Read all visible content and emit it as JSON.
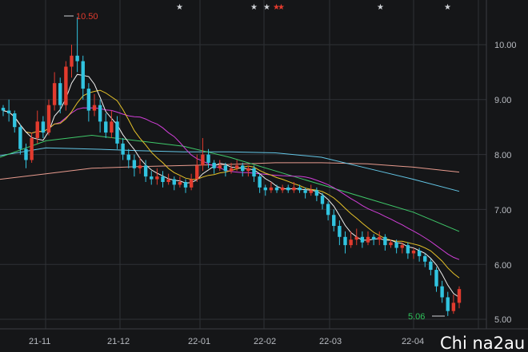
{
  "chart_data": {
    "type": "candlestick",
    "y_ticks": [
      "10.00",
      "9.00",
      "8.00",
      "7.00",
      "6.00",
      "5.00"
    ],
    "x_labels": [
      "21-11",
      "21-12",
      "22-01",
      "22-02",
      "22-03",
      "22-04"
    ],
    "annotations": {
      "high": "10.50",
      "low": "5.06"
    },
    "colors": {
      "up": "#e23b2e",
      "down": "#31c4e0",
      "ma5": "#f0f0f0",
      "ma10": "#e6c229",
      "ma20": "#d13fd8",
      "ma60": "#3fc96a",
      "ma120": "#63c6e6",
      "ma250": "#e89b8e",
      "grid": "#2f3136",
      "background": "#151618"
    },
    "markers": [
      {
        "type": "star"
      },
      {
        "type": "star"
      },
      {
        "type": "star"
      },
      {
        "type": "star-red"
      },
      {
        "type": "star-red"
      },
      {
        "type": "star"
      },
      {
        "type": "star"
      }
    ],
    "ma60_series": [
      7.95,
      8.25,
      8.35,
      8.25,
      8.15,
      7.95,
      7.7,
      7.45,
      7.2,
      6.95,
      6.6
    ],
    "ma120_series": [
      7.98,
      8.12,
      8.1,
      8.07,
      8.05,
      8.05,
      8.03,
      7.95,
      7.75,
      7.55,
      7.33
    ],
    "ma250_series": [
      7.55,
      7.65,
      7.75,
      7.78,
      7.8,
      7.82,
      7.85,
      7.85,
      7.83,
      7.77,
      7.68
    ],
    "candles": [
      [
        8.85,
        8.8,
        8.9,
        8.7
      ],
      [
        8.8,
        8.75,
        9.0,
        8.6
      ],
      [
        8.75,
        8.5,
        8.8,
        8.4
      ],
      [
        8.5,
        8.1,
        8.55,
        8.0
      ],
      [
        8.1,
        7.9,
        8.2,
        7.75
      ],
      [
        7.9,
        8.3,
        8.4,
        7.85
      ],
      [
        8.3,
        8.6,
        8.8,
        8.2
      ],
      [
        8.6,
        8.4,
        8.7,
        8.3
      ],
      [
        8.4,
        8.9,
        9.0,
        8.35
      ],
      [
        8.9,
        9.3,
        9.5,
        8.8
      ],
      [
        9.3,
        8.9,
        9.4,
        8.75
      ],
      [
        8.9,
        9.6,
        9.7,
        8.8
      ],
      [
        9.6,
        9.8,
        10.0,
        9.4
      ],
      [
        9.8,
        9.7,
        10.5,
        9.5
      ],
      [
        9.7,
        9.2,
        9.8,
        9.0
      ],
      [
        9.2,
        8.8,
        9.3,
        8.6
      ],
      [
        8.8,
        8.9,
        9.1,
        8.7
      ],
      [
        8.9,
        8.6,
        9.0,
        8.4
      ],
      [
        8.6,
        8.4,
        8.75,
        8.3
      ],
      [
        8.4,
        8.6,
        8.8,
        8.3
      ],
      [
        8.6,
        8.2,
        8.7,
        8.1
      ],
      [
        8.2,
        8.0,
        8.3,
        7.9
      ],
      [
        8.0,
        7.9,
        8.1,
        7.75
      ],
      [
        7.9,
        7.75,
        8.0,
        7.6
      ],
      [
        7.75,
        7.8,
        7.95,
        7.65
      ],
      [
        7.8,
        7.6,
        7.9,
        7.5
      ],
      [
        7.6,
        7.55,
        7.7,
        7.45
      ],
      [
        7.55,
        7.6,
        7.75,
        7.45
      ],
      [
        7.6,
        7.5,
        7.7,
        7.4
      ],
      [
        7.5,
        7.55,
        7.65,
        7.45
      ],
      [
        7.55,
        7.45,
        7.6,
        7.35
      ],
      [
        7.45,
        7.5,
        7.6,
        7.4
      ],
      [
        7.5,
        7.4,
        7.55,
        7.3
      ],
      [
        7.4,
        7.55,
        7.65,
        7.35
      ],
      [
        7.55,
        7.8,
        8.0,
        7.5
      ],
      [
        7.8,
        8.0,
        8.3,
        7.7
      ],
      [
        8.0,
        7.85,
        8.1,
        7.75
      ],
      [
        7.85,
        7.75,
        7.9,
        7.65
      ],
      [
        7.75,
        7.8,
        7.9,
        7.7
      ],
      [
        7.8,
        7.7,
        7.85,
        7.6
      ],
      [
        7.7,
        7.75,
        7.85,
        7.65
      ],
      [
        7.75,
        7.8,
        7.9,
        7.7
      ],
      [
        7.8,
        7.7,
        7.85,
        7.6
      ],
      [
        7.7,
        7.75,
        7.8,
        7.6
      ],
      [
        7.75,
        7.6,
        7.8,
        7.5
      ],
      [
        7.6,
        7.4,
        7.65,
        7.3
      ],
      [
        7.4,
        7.35,
        7.45,
        7.25
      ],
      [
        7.35,
        7.4,
        7.5,
        7.3
      ],
      [
        7.4,
        7.35,
        7.45,
        7.3
      ],
      [
        7.35,
        7.4,
        7.45,
        7.3
      ],
      [
        7.4,
        7.35,
        7.45,
        7.3
      ],
      [
        7.35,
        7.4,
        7.5,
        7.3
      ],
      [
        7.4,
        7.35,
        7.45,
        7.3
      ],
      [
        7.35,
        7.3,
        7.4,
        7.2
      ],
      [
        7.3,
        7.35,
        7.45,
        7.25
      ],
      [
        7.35,
        7.25,
        7.4,
        7.15
      ],
      [
        7.25,
        7.1,
        7.3,
        7.0
      ],
      [
        7.1,
        6.9,
        7.15,
        6.8
      ],
      [
        6.9,
        6.7,
        7.0,
        6.6
      ],
      [
        6.7,
        6.5,
        6.8,
        6.35
      ],
      [
        6.5,
        6.35,
        6.6,
        6.2
      ],
      [
        6.35,
        6.45,
        6.6,
        6.3
      ],
      [
        6.45,
        6.5,
        6.65,
        6.35
      ],
      [
        6.5,
        6.4,
        6.6,
        6.3
      ],
      [
        6.4,
        6.5,
        6.6,
        6.35
      ],
      [
        6.5,
        6.45,
        6.55,
        6.35
      ],
      [
        6.45,
        6.5,
        6.6,
        6.35
      ],
      [
        6.5,
        6.35,
        6.55,
        6.25
      ],
      [
        6.35,
        6.4,
        6.45,
        6.3
      ],
      [
        6.4,
        6.3,
        6.45,
        6.2
      ],
      [
        6.3,
        6.35,
        6.4,
        6.2
      ],
      [
        6.35,
        6.2,
        6.4,
        6.1
      ],
      [
        6.2,
        6.25,
        6.3,
        6.1
      ],
      [
        6.25,
        6.15,
        6.3,
        6.05
      ],
      [
        6.15,
        6.05,
        6.2,
        5.95
      ],
      [
        6.05,
        5.9,
        6.1,
        5.8
      ],
      [
        5.9,
        5.6,
        5.95,
        5.5
      ],
      [
        5.6,
        5.4,
        5.7,
        5.3
      ],
      [
        5.4,
        5.15,
        5.5,
        5.06
      ],
      [
        5.15,
        5.3,
        5.45,
        5.1
      ],
      [
        5.3,
        5.55,
        5.6,
        5.2
      ]
    ]
  },
  "watermark": "Chi na2au"
}
